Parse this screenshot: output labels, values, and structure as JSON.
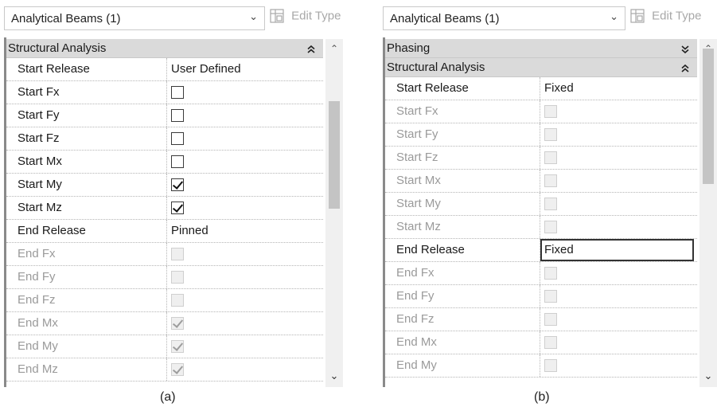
{
  "panel_a": {
    "type_selector": "Analytical Beams (1)",
    "edit_type": "Edit Type",
    "groups": [
      {
        "label": "Structural Analysis"
      }
    ],
    "rows": [
      {
        "name": "Start Release",
        "value": "User Defined"
      },
      {
        "name": "Start Fx",
        "checked": false
      },
      {
        "name": "Start Fy",
        "checked": false
      },
      {
        "name": "Start Fz",
        "checked": false
      },
      {
        "name": "Start Mx",
        "checked": false
      },
      {
        "name": "Start My",
        "checked": true
      },
      {
        "name": "Start Mz",
        "checked": true
      },
      {
        "name": "End Release",
        "value": "Pinned"
      },
      {
        "name": "End Fx",
        "checked": false,
        "disabled": true
      },
      {
        "name": "End Fy",
        "checked": false,
        "disabled": true
      },
      {
        "name": "End Fz",
        "checked": false,
        "disabled": true
      },
      {
        "name": "End Mx",
        "checked": true,
        "disabled": true
      },
      {
        "name": "End My",
        "checked": true,
        "disabled": true
      },
      {
        "name": "End Mz",
        "checked": true,
        "disabled": true
      }
    ],
    "caption": "(a)"
  },
  "panel_b": {
    "type_selector": "Analytical Beams (1)",
    "edit_type": "Edit Type",
    "groups": [
      {
        "label": "Phasing",
        "collapsed": true
      },
      {
        "label": "Structural Analysis",
        "collapsed": false
      }
    ],
    "rows": [
      {
        "name": "Start Release",
        "value": "Fixed"
      },
      {
        "name": "Start Fx",
        "checked": false,
        "disabled": true
      },
      {
        "name": "Start Fy",
        "checked": false,
        "disabled": true
      },
      {
        "name": "Start Fz",
        "checked": false,
        "disabled": true
      },
      {
        "name": "Start Mx",
        "checked": false,
        "disabled": true
      },
      {
        "name": "Start My",
        "checked": false,
        "disabled": true
      },
      {
        "name": "Start Mz",
        "checked": false,
        "disabled": true
      },
      {
        "name": "End Release",
        "value": "Fixed",
        "editing": true
      },
      {
        "name": "End Fx",
        "checked": false,
        "disabled": true
      },
      {
        "name": "End Fy",
        "checked": false,
        "disabled": true
      },
      {
        "name": "End Fz",
        "checked": false,
        "disabled": true
      },
      {
        "name": "End Mx",
        "checked": false,
        "disabled": true
      },
      {
        "name": "End My",
        "checked": false,
        "disabled": true
      }
    ],
    "caption": "(b)"
  },
  "icons": {
    "dropdown": "chevron-down-icon",
    "edit_type": "edit-type-icon",
    "collapse": "double-chevron-up-icon",
    "expand": "double-chevron-down-icon",
    "scroll_up": "scroll-up-icon",
    "scroll_down": "scroll-down-icon"
  },
  "colors": {
    "group_header_bg": "#dadada",
    "disabled_text": "#9a9a9a",
    "scrollbar_thumb": "#c4c4c4"
  }
}
